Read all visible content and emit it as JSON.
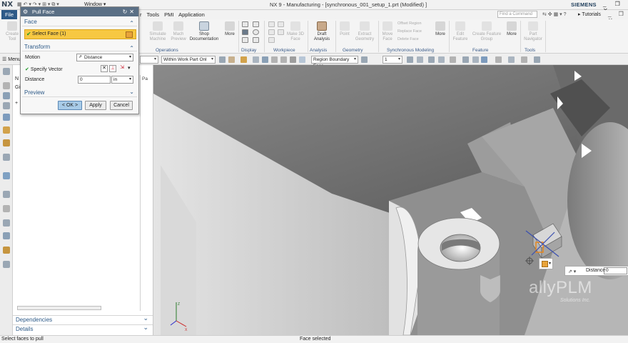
{
  "titlebar": {
    "logo": "NX",
    "window_menu": "Window ▾",
    "title": "NX 9 - Manufacturing - [synchronous_001_setup_1.prt (Modified) ]",
    "brand": "SIEMENS",
    "window_buttons": "_ ❐ ✕"
  },
  "menubar": {
    "file": "File",
    "items": [
      "r",
      "Tools",
      "PMI",
      "Application"
    ],
    "find_command_placeholder": "Find a Command",
    "tutorials": "Tutorials",
    "right_end": "_ ❐ ✕"
  },
  "ribbon": {
    "buttons": [
      {
        "label": "Create\nTool",
        "dim": true
      },
      {
        "label": "Simulate\nMachine",
        "dim": true
      },
      {
        "label": "Mach\nPreview",
        "dim": true
      },
      {
        "label": "Shop\nDocumentation",
        "dim": false
      },
      {
        "label": "More",
        "dim": false
      },
      {
        "label": "Make 3D\nFace",
        "dim": true
      },
      {
        "label": "Draft\nAnalysis",
        "dim": false
      },
      {
        "label": "Point",
        "dim": true
      },
      {
        "label": "Extract\nGeometry",
        "dim": true
      },
      {
        "label": "Move\nFace",
        "dim": true
      },
      {
        "label": "More",
        "dim": false
      },
      {
        "label": "Edit\nFeature",
        "dim": true
      },
      {
        "label": "Create Feature\nGroup",
        "dim": true
      },
      {
        "label": "More",
        "dim": false
      },
      {
        "label": "Part\nNavigator",
        "dim": true
      }
    ],
    "sync_small": [
      "Offset Region",
      "Replace Face",
      "Delete Face"
    ],
    "groups": [
      "Operations",
      "Display",
      "Workpiece",
      "Analysis",
      "Geometry",
      "Synchronous Modeling",
      "Feature",
      "Tools"
    ],
    "accent": "#3b5b88"
  },
  "selection_bar": {
    "menu": "Menu ▾",
    "scope": "Within Work Part Onl",
    "face_rule": "Region Boundary Face",
    "count": "1"
  },
  "navigator": {
    "column_pa": "Pa",
    "row_n": "N",
    "row_gi": "Gi",
    "sections": [
      "Dependencies",
      "Details"
    ]
  },
  "dialog": {
    "title": "Pull Face",
    "sections": {
      "face": "Face",
      "transform": "Transform",
      "preview": "Preview"
    },
    "select_face": "Select Face (1)",
    "motion_label": "Motion",
    "motion_value": "Distance",
    "specify_vector": "Specify Vector",
    "distance_label": "Distance",
    "distance_value": "0",
    "distance_unit": "in",
    "buttons": {
      "ok": "< OK >",
      "apply": "Apply",
      "cancel": "Cancel"
    }
  },
  "viewport": {
    "watermark": "allyPLM",
    "watermark_sub": "Solutions Inc.",
    "distance_label": "Distance",
    "distance_value": "0"
  },
  "status": {
    "left": "Select faces to pull",
    "center": "Face selected"
  }
}
